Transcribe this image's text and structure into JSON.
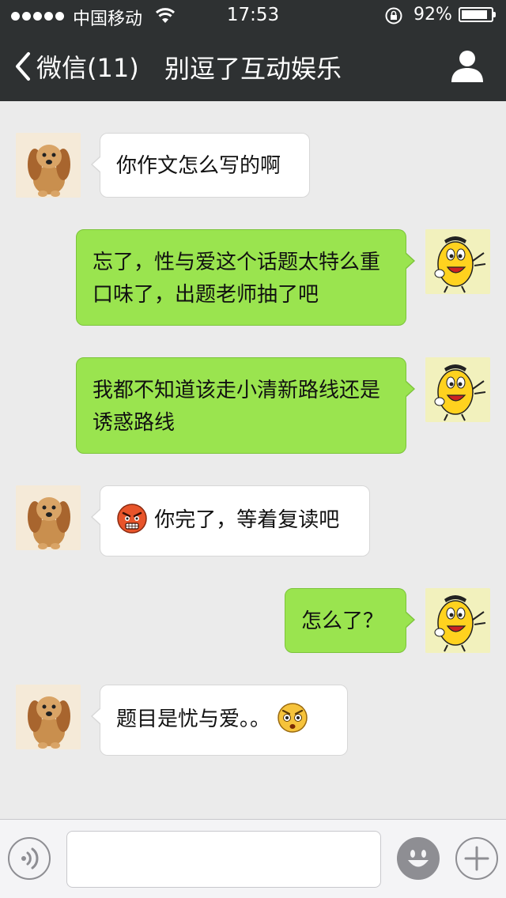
{
  "status_bar": {
    "carrier": "中国移动",
    "time": "17:53",
    "battery_percent": "92%",
    "battery_level": 0.92,
    "signal_bars": 5
  },
  "nav": {
    "back_label": "微信(11)",
    "title": "别逗了互动娱乐"
  },
  "messages": [
    {
      "side": "in",
      "text": "你作文怎么写的啊"
    },
    {
      "side": "out",
      "text": "忘了，性与爱这个话题太特么重口味了，出题老师抽了吧"
    },
    {
      "side": "out",
      "text": "我都不知道该走小清新路线还是诱惑路线"
    },
    {
      "side": "in",
      "emoji_before": "angry-face-icon",
      "text": "你完了，等着复读吧"
    },
    {
      "side": "out",
      "text": "怎么了？"
    },
    {
      "side": "in",
      "text": "题目是忧与爱。。",
      "emoji_after": "shocked-face-icon"
    }
  ],
  "colors": {
    "header_bg": "#2e3132",
    "chat_bg": "#ebebeb",
    "outgoing_bubble": "#9ae44f",
    "incoming_bubble": "#ffffff",
    "input_bar_bg": "#f4f4f6"
  },
  "input": {
    "value": "",
    "placeholder": ""
  }
}
